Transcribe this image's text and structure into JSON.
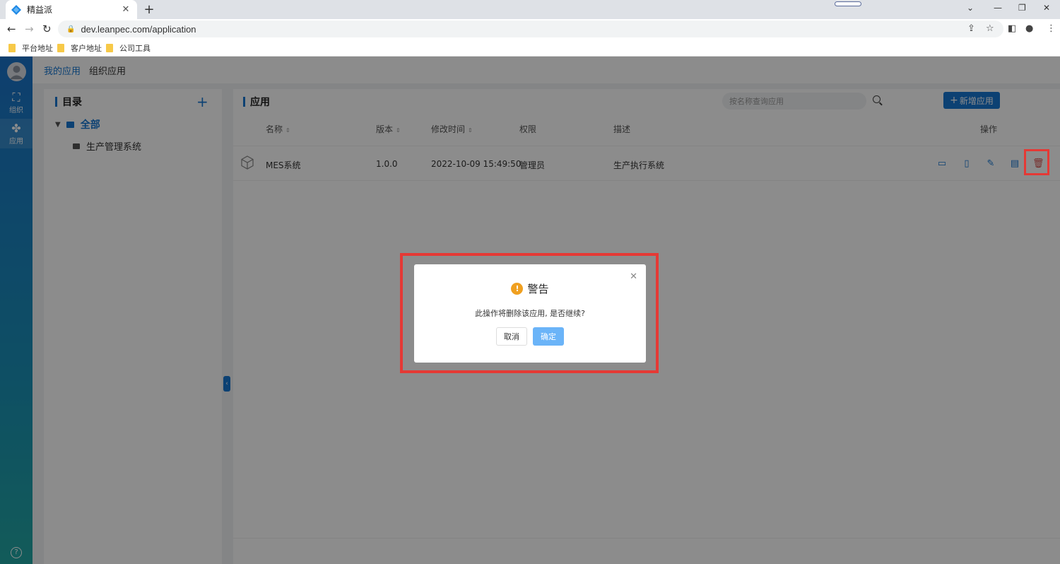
{
  "browser": {
    "tab_title": "精益派",
    "url": "dev.leanpec.com/application",
    "bookmarks": [
      "平台地址",
      "客户地址",
      "公司工具"
    ]
  },
  "sidebar": {
    "items": [
      {
        "label": "组织",
        "icon": "org-icon"
      },
      {
        "label": "应用",
        "icon": "apps-icon"
      }
    ]
  },
  "topnav": {
    "my_apps": "我的应用",
    "org_apps": "组织应用"
  },
  "catalog": {
    "title": "目录",
    "root": "全部",
    "children": [
      "生产管理系统"
    ]
  },
  "apps": {
    "title": "应用",
    "search_placeholder": "按名称查询应用",
    "add_label": "新增应用",
    "columns": {
      "name": "名称",
      "version": "版本",
      "modified": "修改时间",
      "permission": "权限",
      "description": "描述",
      "actions": "操作"
    },
    "rows": [
      {
        "name": "MES系统",
        "version": "1.0.0",
        "modified": "2022-10-09 15:49:50",
        "permission": "管理员",
        "description": "生产执行系统"
      }
    ]
  },
  "dialog": {
    "title": "警告",
    "message": "此操作将删除该应用, 是否继续?",
    "cancel": "取消",
    "confirm": "确定"
  },
  "colors": {
    "accent": "#1677d2",
    "warning": "#f0a020",
    "highlight": "#e53935"
  }
}
